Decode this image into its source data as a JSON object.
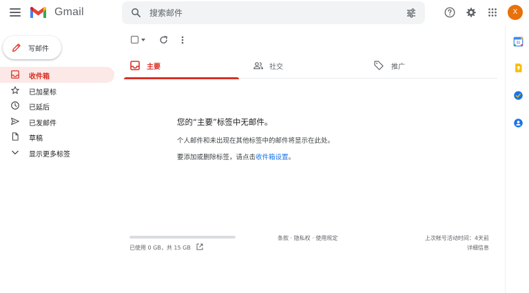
{
  "header": {
    "app_name": "Gmail",
    "search_placeholder": "搜索邮件",
    "avatar_initial": "X"
  },
  "sidebar": {
    "compose_label": "写邮件",
    "items": [
      {
        "label": "收件箱",
        "icon": "inbox-icon",
        "active": true
      },
      {
        "label": "已加星标",
        "icon": "star-icon",
        "active": false
      },
      {
        "label": "已延后",
        "icon": "clock-icon",
        "active": false
      },
      {
        "label": "已发邮件",
        "icon": "send-icon",
        "active": false
      },
      {
        "label": "草稿",
        "icon": "draft-icon",
        "active": false
      },
      {
        "label": "显示更多标签",
        "icon": "chevron-down-icon",
        "active": false
      }
    ]
  },
  "tabs": [
    {
      "label": "主要",
      "icon": "inbox-icon",
      "active": true
    },
    {
      "label": "社交",
      "icon": "people-icon",
      "active": false
    },
    {
      "label": "推广",
      "icon": "tag-icon",
      "active": false
    }
  ],
  "empty_state": {
    "title": "您的“主要”标签中无邮件。",
    "description": "个人邮件和未出现在其他标签中的邮件将显示在此处。",
    "action_prefix": "要添加或删除标签，请点击",
    "action_link": "收件箱设置",
    "action_suffix": "。"
  },
  "footer": {
    "storage_text": "已使用 0 GB，共 15 GB",
    "storage_used_fraction": 0,
    "links": "条款 · 隐私权 · 使用规定",
    "last_activity": "上次帐号活动时间：4天前",
    "details": "详细信息"
  },
  "colors": {
    "accent_red": "#d93025",
    "active_bg": "#fce8e6",
    "link_blue": "#1a73e8",
    "avatar_orange": "#e8710a"
  },
  "side_apps": [
    "calendar-icon",
    "keep-icon",
    "tasks-icon",
    "contacts-icon"
  ]
}
